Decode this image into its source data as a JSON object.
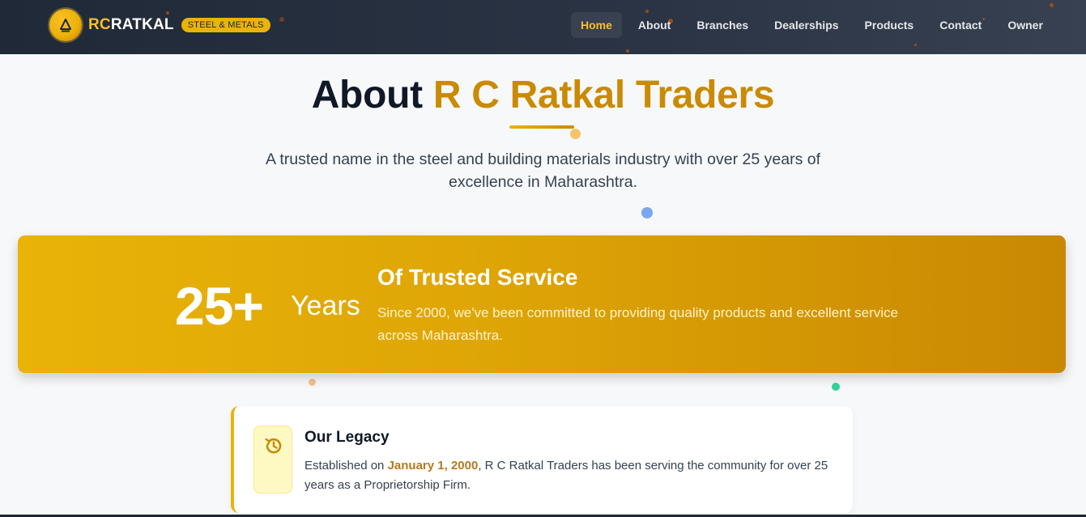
{
  "nav": {
    "brand_prefix": "RC",
    "brand_suffix": "RATKAL",
    "badge": "STEEL & METALS",
    "logo_icon": "triangle-logo-icon",
    "links": [
      "Home",
      "About",
      "Branches",
      "Dealerships",
      "Products",
      "Contact",
      "Owner"
    ],
    "active": "Home"
  },
  "hero": {
    "title_plain": "About",
    "title_highlight": "R C Ratkal Traders",
    "subtitle": "A trusted name in the steel and building materials industry with over 25 years of excellence in Maharashtra."
  },
  "banner": {
    "years_number": "25+",
    "years_word": "Years",
    "title": "Of Trusted Service",
    "text": "Since 2000, we've been committed to providing quality products and excellent service across Maharashtra."
  },
  "legacy": {
    "icon": "history-icon",
    "title": "Our Legacy",
    "text_before": "Established on",
    "date": "January 1, 2000",
    "text_after": ", R C Ratkal Traders has been serving the community for over 25 years as a Proprietorship Firm."
  },
  "colors": {
    "navbar": "#1f2937",
    "accent": "#eab308",
    "gold_text": "#ca8a04",
    "page_bg": "#f7f8fa"
  }
}
